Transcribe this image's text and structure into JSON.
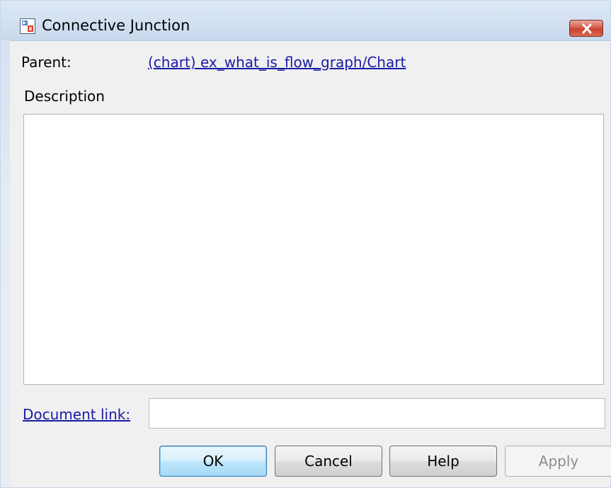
{
  "window": {
    "title": "Connective Junction",
    "icon": "stateflow-app-icon",
    "close_icon": "close-icon"
  },
  "parent": {
    "label": "Parent:",
    "link_text": "(chart) ex_what_is_flow_graph/Chart"
  },
  "description": {
    "label": "Description",
    "value": ""
  },
  "document_link": {
    "label": "Document link:",
    "value": ""
  },
  "buttons": {
    "ok": "OK",
    "cancel": "Cancel",
    "help": "Help",
    "apply": "Apply"
  },
  "colors": {
    "link": "#1a1aa6",
    "close_button": "#c8412d",
    "default_button": "#a7d9f5",
    "disabled_text": "#8d8d8d"
  }
}
